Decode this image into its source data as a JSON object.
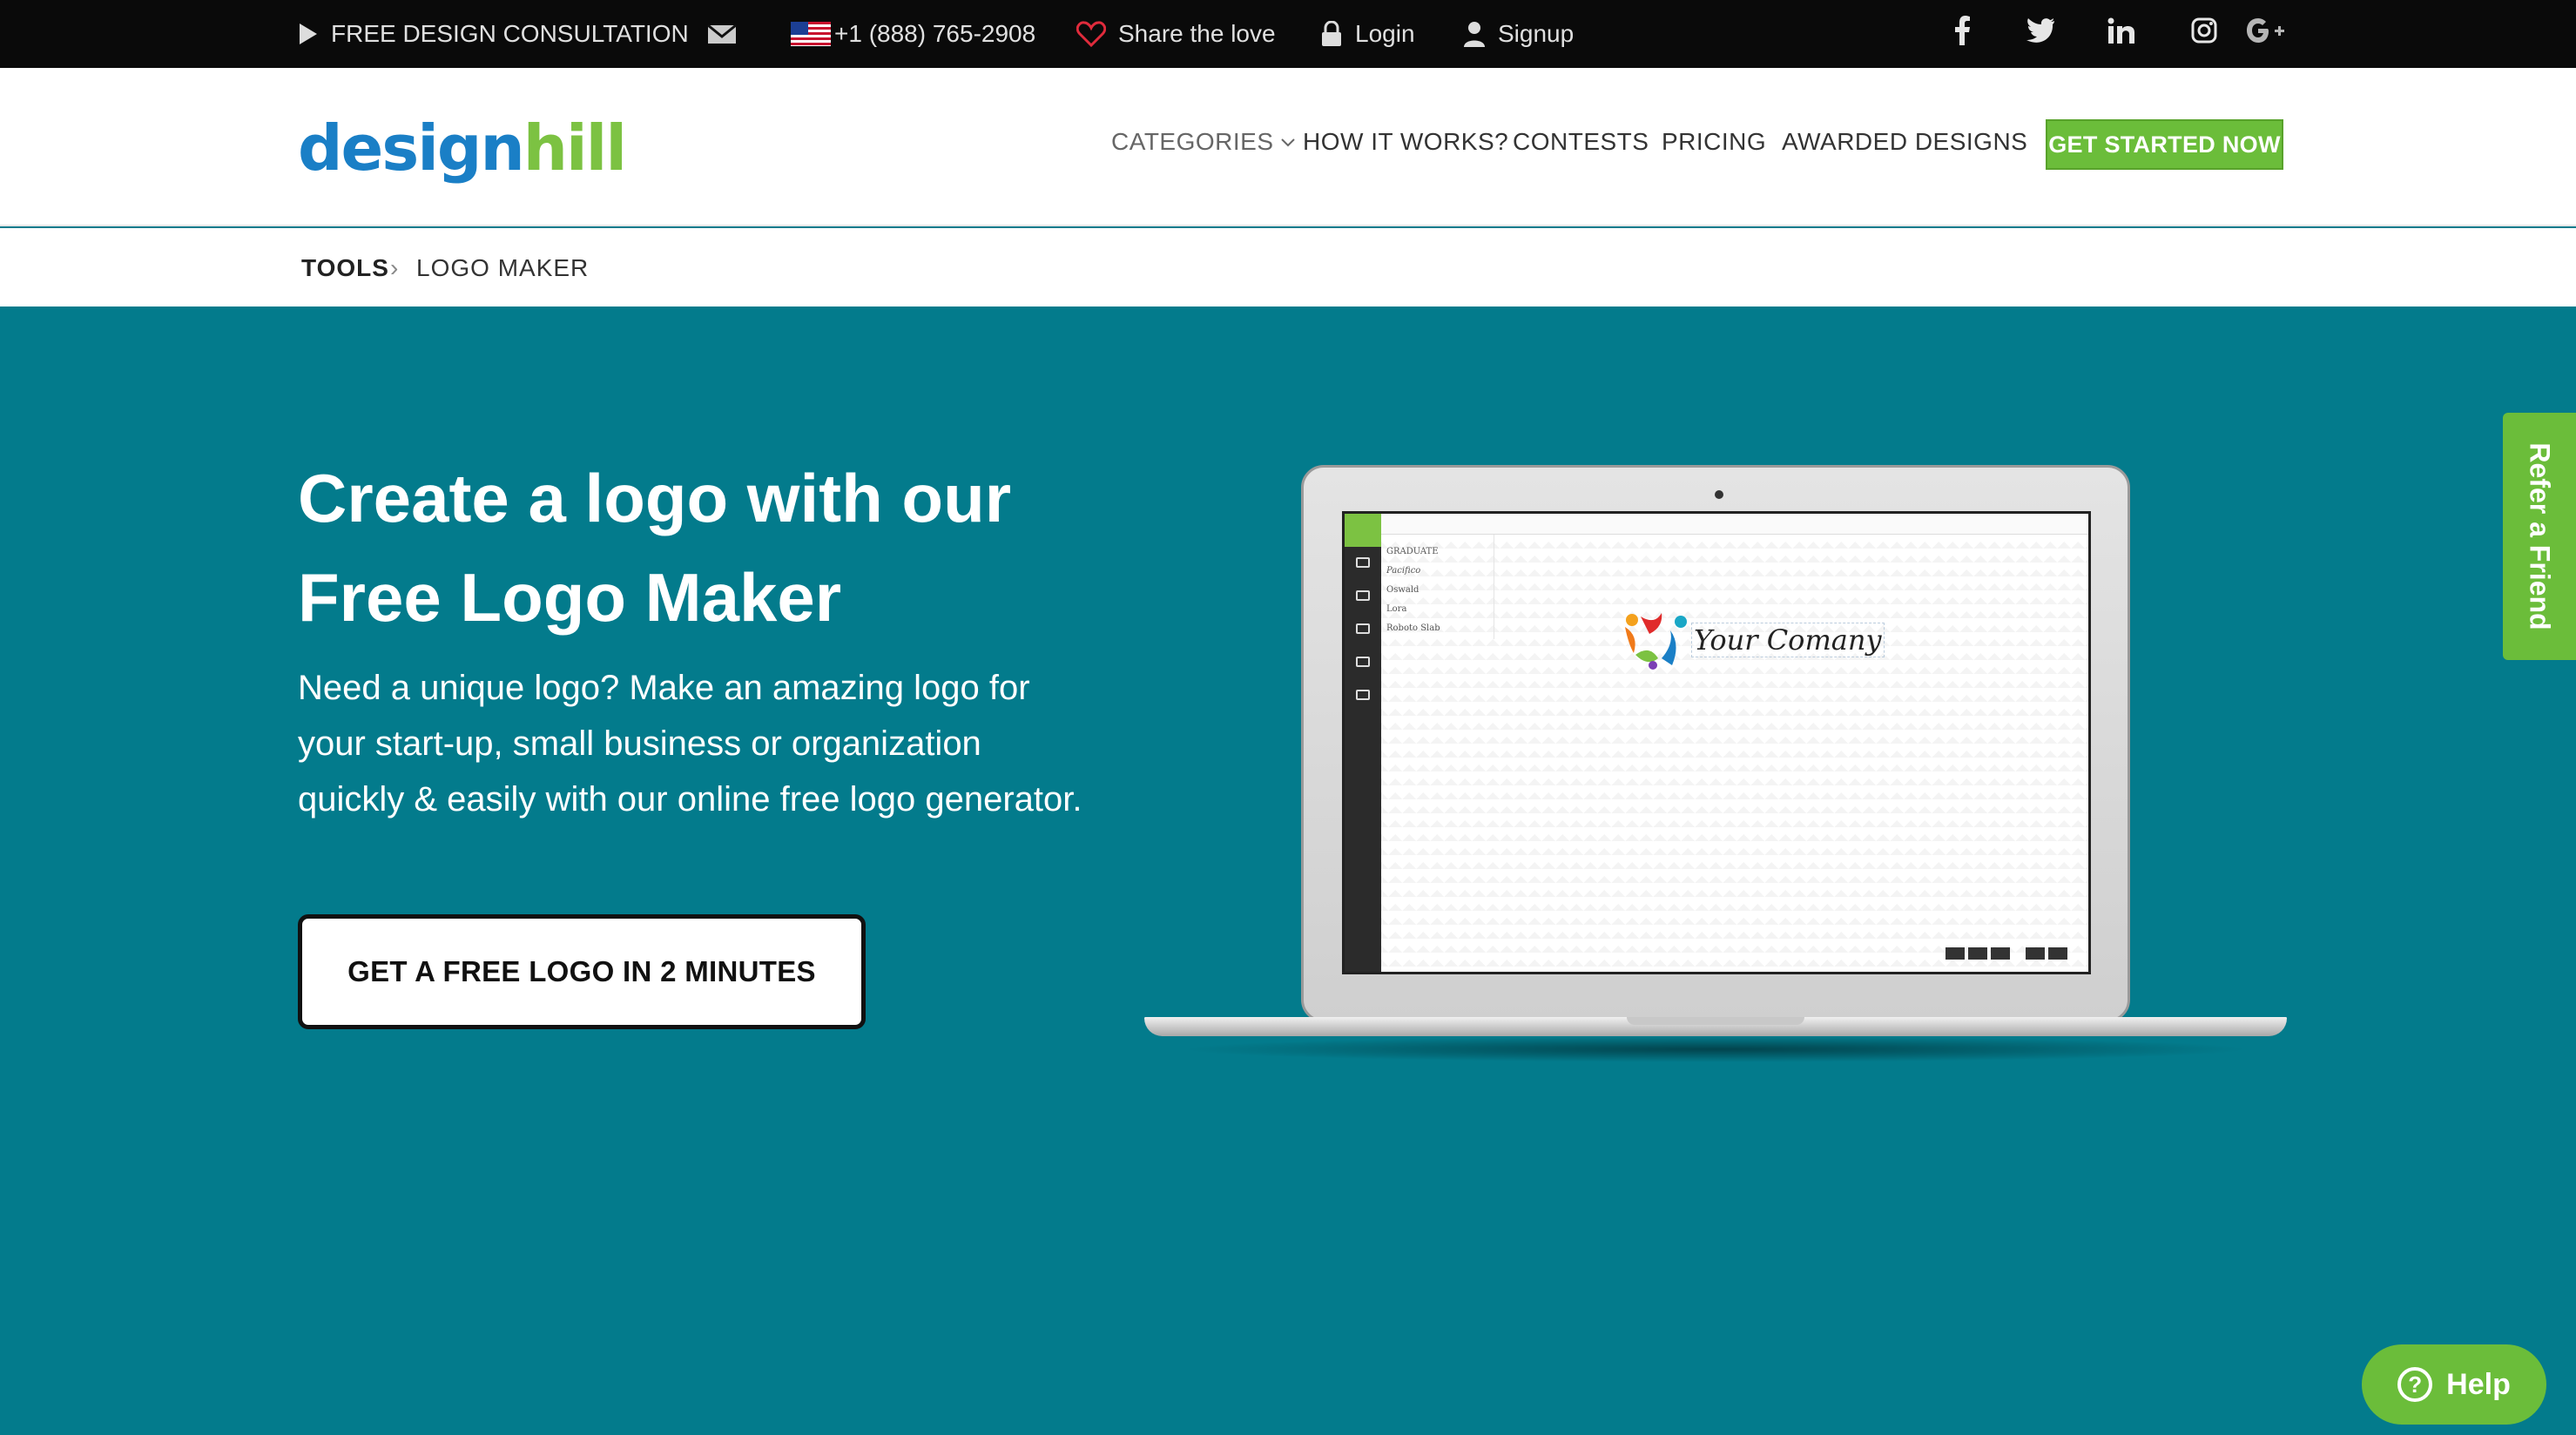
{
  "topbar": {
    "consultation": "FREE DESIGN CONSULTATION",
    "phone": "+1 (888) 765-2908",
    "share": "Share the love",
    "login": "Login",
    "signup": "Signup",
    "social": [
      "facebook-icon",
      "twitter-icon",
      "linkedin-icon",
      "instagram-icon",
      "google-plus-icon"
    ]
  },
  "header": {
    "logo_part1": "design",
    "logo_part2": "hill",
    "nav": {
      "categories": "CATEGORIES",
      "how_it_works": "HOW IT WORKS?",
      "contests": "CONTESTS",
      "pricing": "PRICING",
      "awarded": "AWARDED DESIGNS"
    },
    "cta": "GET STARTED NOW"
  },
  "breadcrumb": {
    "tools": "TOOLS",
    "separator": "›",
    "current": "LOGO MAKER"
  },
  "hero": {
    "title_line1": "Create a logo with our",
    "title_line2": "Free Logo Maker",
    "description_line1": "Need a unique logo? Make an amazing logo for",
    "description_line2": "your start-up, small business or organization",
    "description_line3": "quickly & easily with our online free logo generator.",
    "button": "GET A FREE LOGO IN 2 MINUTES"
  },
  "mockup": {
    "fonts": [
      "GRADUATE",
      "Pacifico",
      "Oswald",
      "Lora",
      "Roboto Slab"
    ],
    "logo_text": "Your Comany"
  },
  "refer": "Refer a Friend",
  "help": {
    "icon": "?",
    "label": "Help"
  },
  "colors": {
    "hero_bg": "#037b8c",
    "accent_green": "#6bbd3a",
    "logo_blue": "#1a7fc6",
    "topbar_bg": "#0a0a0a"
  }
}
